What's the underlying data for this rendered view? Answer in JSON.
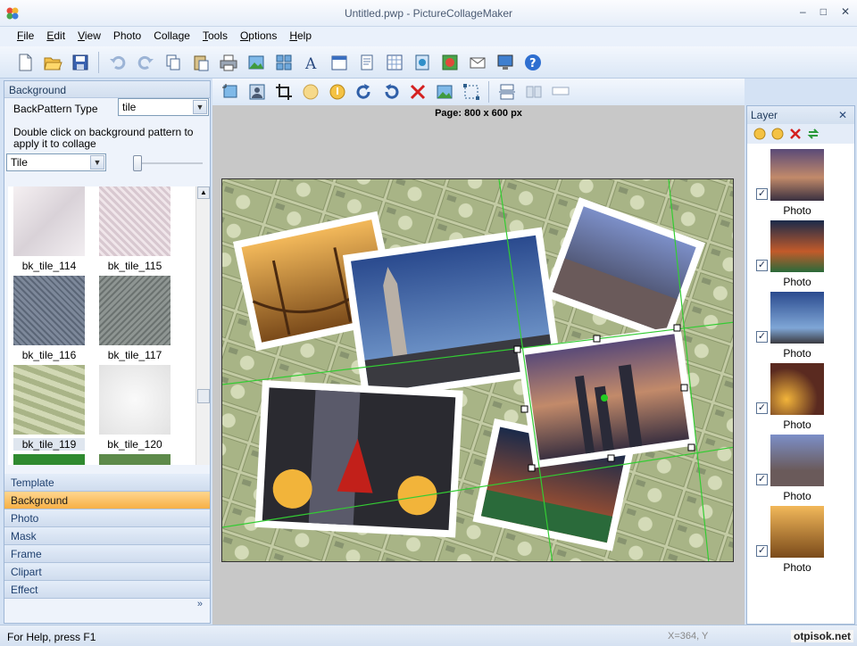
{
  "window": {
    "title": "Untitled.pwp - PictureCollageMaker",
    "min": "–",
    "max": "□",
    "close": "✕"
  },
  "menu": [
    {
      "pre": "",
      "u": "F",
      "post": "ile"
    },
    {
      "pre": "",
      "u": "E",
      "post": "dit"
    },
    {
      "pre": "",
      "u": "V",
      "post": "iew"
    },
    {
      "pre": "Photo",
      "u": "",
      "post": ""
    },
    {
      "pre": "Collage",
      "u": "",
      "post": ""
    },
    {
      "pre": "",
      "u": "T",
      "post": "ools"
    },
    {
      "pre": "",
      "u": "O",
      "post": "ptions"
    },
    {
      "pre": "",
      "u": "H",
      "post": "elp"
    }
  ],
  "left_panel": {
    "header": "Background",
    "backpattern_label": "BackPattern Type",
    "backpattern_value": "tile",
    "hint": "Double click on background pattern to apply it to collage",
    "pattern_select": "Tile",
    "thumbnails": [
      {
        "caption": "bk_tile_114"
      },
      {
        "caption": "bk_tile_115"
      },
      {
        "caption": "bk_tile_116"
      },
      {
        "caption": "bk_tile_117"
      },
      {
        "caption": "bk_tile_119"
      },
      {
        "caption": "bk_tile_120"
      }
    ],
    "tabs": [
      "Template",
      "Background",
      "Photo",
      "Mask",
      "Frame",
      "Clipart",
      "Effect"
    ],
    "active_tab": "Background",
    "more": "»"
  },
  "canvas": {
    "page_label": "Page: 800 x 600 px"
  },
  "layer_panel": {
    "header": "Layer",
    "close": "✕",
    "layers": [
      {
        "caption": "Photo",
        "checked": "✓"
      },
      {
        "caption": "Photo",
        "checked": "✓"
      },
      {
        "caption": "Photo",
        "checked": "✓"
      },
      {
        "caption": "Photo",
        "checked": "✓"
      },
      {
        "caption": "Photo",
        "checked": "✓"
      },
      {
        "caption": "Photo",
        "checked": "✓"
      }
    ]
  },
  "status": {
    "help": "For Help, press F1",
    "coord": "X=364, Y",
    "watermark": "otpisok.net"
  },
  "colors": {
    "accent_tab": "#f7b046",
    "panel_bg": "#d4e2f4",
    "money_green": "#b9c29a",
    "guide_green": "#33cc33"
  }
}
